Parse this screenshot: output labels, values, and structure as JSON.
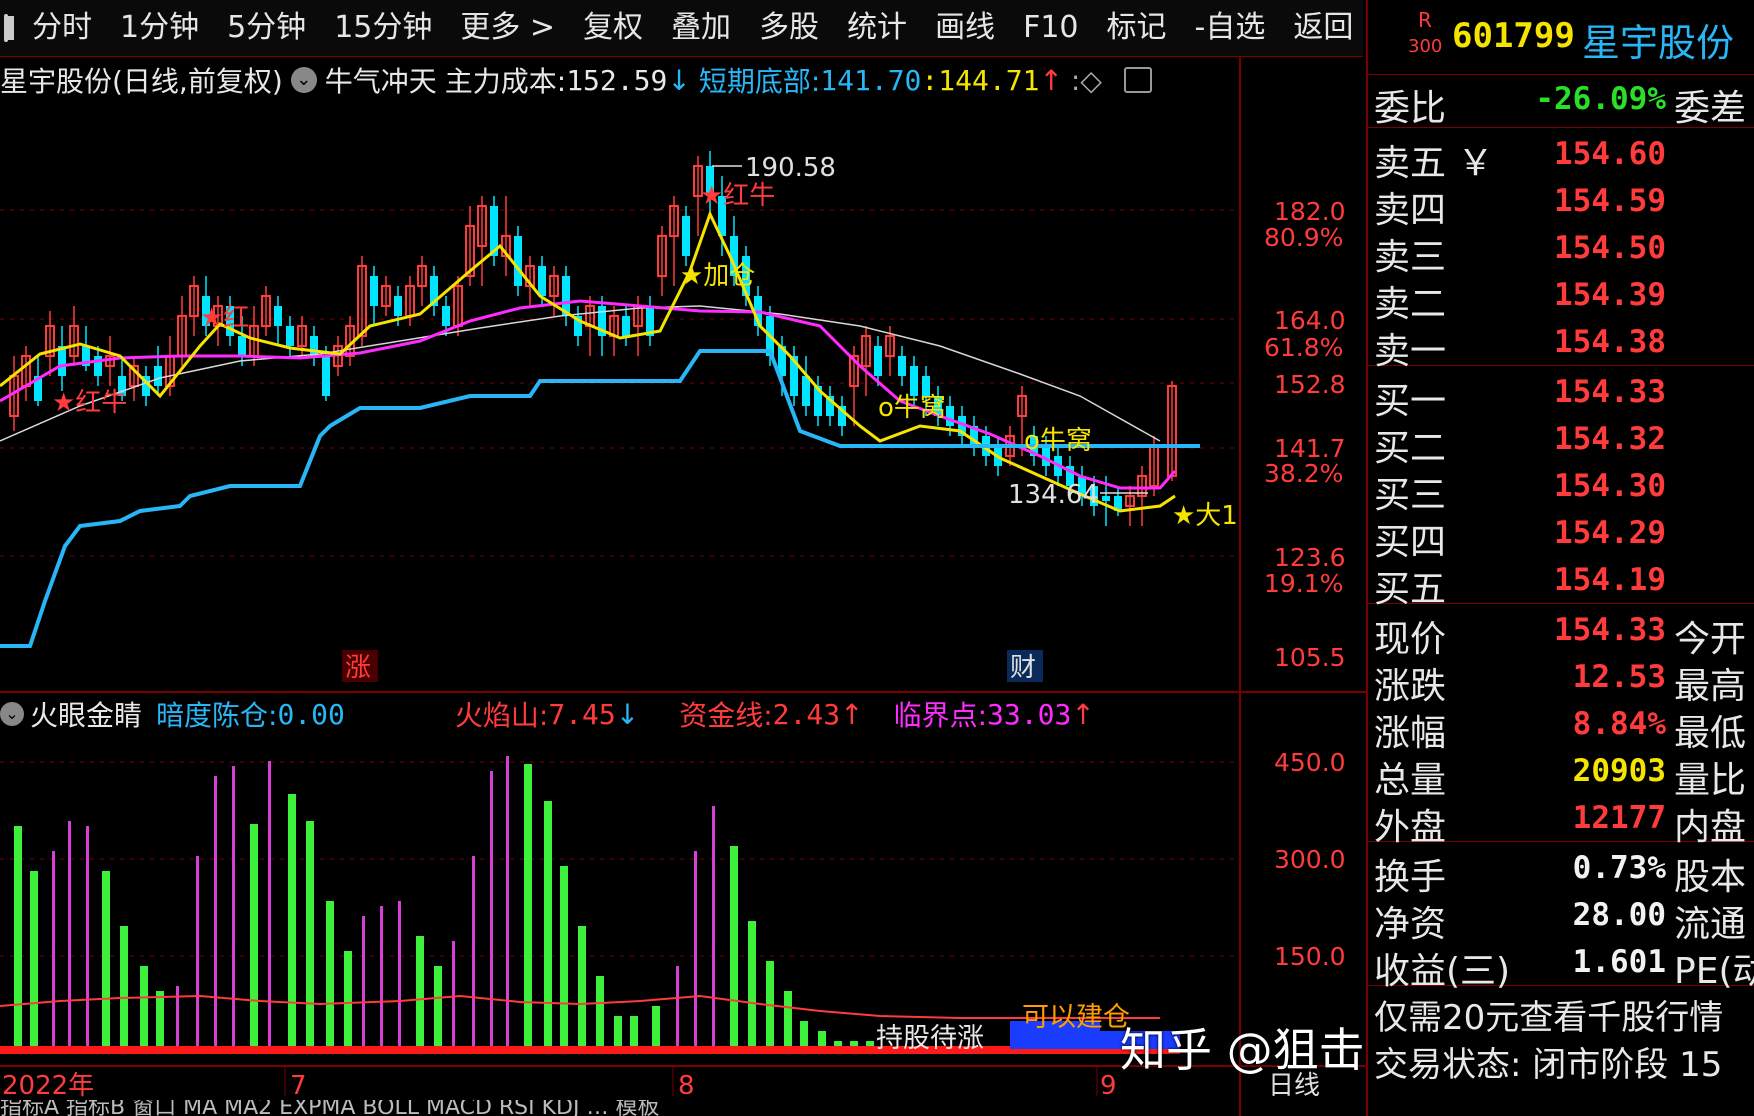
{
  "toolbar": {
    "items": [
      "分时",
      "1分钟",
      "5分钟",
      "15分钟",
      "更多 >",
      "复权",
      "叠加",
      "多股",
      "统计",
      "画线",
      "F10",
      "标记",
      "-自选",
      "返回"
    ]
  },
  "chart_info": {
    "title": "星宇股份(日线,前复权)",
    "indicator_name": "牛气冲天",
    "main_cost_label": "主力成本:",
    "main_cost_value": "152.59",
    "main_cost_arrow": "↓",
    "short_bottom_label": "短期底部:",
    "short_bottom_value": "141.70",
    "short_bottom_value2": ":144.71",
    "short_bottom_arrow": "↑",
    "tail": ":◇"
  },
  "price_axis": {
    "labels": [
      "182.0",
      "80.9%",
      "164.0",
      "61.8%",
      "152.8",
      "141.7",
      "38.2%",
      "123.6",
      "19.1%",
      "105.5"
    ]
  },
  "annotations": {
    "high": "190.58",
    "low": "134.64",
    "red_bull_1": "★红牛",
    "red_bull_2": "★红牛",
    "red_bull_3": "★红",
    "add_position": "★加仓",
    "bull_nest_1": "o牛窝",
    "bull_nest_2": "o牛窝",
    "big": "★大1",
    "zhang": "涨",
    "cai": "财"
  },
  "sub_indicator": {
    "name": "火眼金睛",
    "dark_label": "暗度陈仓:",
    "dark_value": "0.00",
    "fire_label": "火焰山:",
    "fire_value": "7.45",
    "fire_arrow": "↓",
    "fund_label": "资金线:",
    "fund_value": "2.43",
    "fund_arrow": "↑",
    "critical_label": "临界点:",
    "critical_value": "33.03",
    "critical_arrow": "↑",
    "axis": [
      "450.0",
      "300.0",
      "150.0"
    ],
    "hold_text": "持股待涨",
    "build_text": "可以建仓"
  },
  "time_axis": {
    "labels": [
      "2022年",
      "7",
      "8",
      "9"
    ],
    "period": "日线"
  },
  "bottom_tabs": "指标A  指标B  窗口  MA  MA2  EXPMA  BOLL  MACD  RSI  KDJ  …  模板",
  "watermark": "知乎 @狙击主力训练营长",
  "quote": {
    "badge_top": "R",
    "badge_bottom": "300",
    "code": "601799",
    "name": "星宇股份",
    "weibi_label": "委比",
    "weibi_value": "-26.09%",
    "weicha_label": "委差",
    "sell": [
      {
        "label": "卖五 ￥",
        "price": "154.60"
      },
      {
        "label": "卖四",
        "price": "154.59"
      },
      {
        "label": "卖三",
        "price": "154.50"
      },
      {
        "label": "卖二",
        "price": "154.39"
      },
      {
        "label": "卖一",
        "price": "154.38"
      }
    ],
    "buy": [
      {
        "label": "买一",
        "price": "154.33"
      },
      {
        "label": "买二",
        "price": "154.32"
      },
      {
        "label": "买三",
        "price": "154.30"
      },
      {
        "label": "买四",
        "price": "154.29"
      },
      {
        "label": "买五",
        "price": "154.19"
      }
    ],
    "stats1": [
      {
        "label": "现价",
        "value": "154.33",
        "right": "今开",
        "color": "red"
      },
      {
        "label": "涨跌",
        "value": "12.53",
        "right": "最高",
        "color": "red"
      },
      {
        "label": "涨幅",
        "value": "8.84%",
        "right": "最低",
        "color": "red"
      },
      {
        "label": "总量",
        "value": "20903",
        "right": "量比",
        "color": "yellow"
      },
      {
        "label": "外盘",
        "value": "12177",
        "right": "内盘",
        "color": "red"
      }
    ],
    "stats2": [
      {
        "label": "换手",
        "value": "0.73%",
        "right": "股本",
        "color": "white"
      },
      {
        "label": "净资",
        "value": "28.00",
        "right": "流通",
        "color": "white"
      },
      {
        "label": "收益(三)",
        "value": "1.601",
        "right": "PE(动",
        "color": "white"
      }
    ],
    "ad_text": "仅需20元查看千股行情",
    "trade_status": "交易状态: 闭市阶段 15"
  },
  "colors": {
    "up": "#ff3b3b",
    "down": "#00e5ff",
    "ma_yellow": "#f4e400",
    "ma_magenta": "#ff2bff",
    "ma_white": "#d8d8d8",
    "support_blue": "#29b6f6",
    "vol_green": "#3cf03c",
    "vol_magenta": "#d640d6",
    "grid_red": "#7a0000"
  }
}
